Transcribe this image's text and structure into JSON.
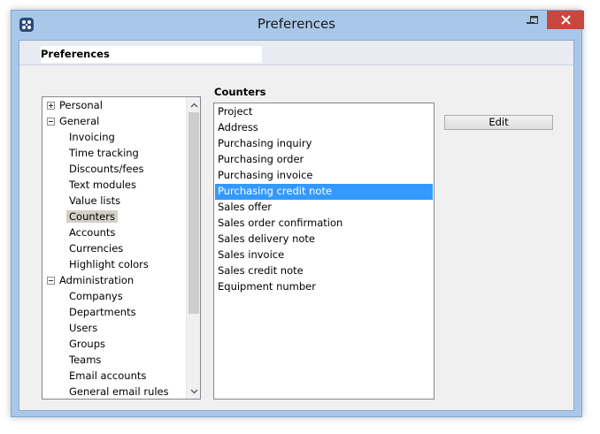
{
  "window": {
    "title": "Preferences"
  },
  "tab": {
    "title": "Preferences"
  },
  "tree": {
    "items": [
      {
        "label": "Personal",
        "level": 0,
        "expander": "plus"
      },
      {
        "label": "General",
        "level": 0,
        "expander": "minus"
      },
      {
        "label": "Invoicing",
        "level": 1
      },
      {
        "label": "Time tracking",
        "level": 1
      },
      {
        "label": "Discounts/fees",
        "level": 1
      },
      {
        "label": "Text modules",
        "level": 1
      },
      {
        "label": "Value lists",
        "level": 1
      },
      {
        "label": "Counters",
        "level": 1,
        "selected": true
      },
      {
        "label": "Accounts",
        "level": 1
      },
      {
        "label": "Currencies",
        "level": 1
      },
      {
        "label": "Highlight colors",
        "level": 1
      },
      {
        "label": "Administration",
        "level": 0,
        "expander": "minus"
      },
      {
        "label": "Companys",
        "level": 1
      },
      {
        "label": "Departments",
        "level": 1
      },
      {
        "label": "Users",
        "level": 1
      },
      {
        "label": "Groups",
        "level": 1
      },
      {
        "label": "Teams",
        "level": 1
      },
      {
        "label": "Email accounts",
        "level": 1
      },
      {
        "label": "General email rules",
        "level": 1
      }
    ]
  },
  "counters": {
    "title": "Counters",
    "items": [
      "Project",
      "Address",
      "Purchasing inquiry",
      "Purchasing order",
      "Purchasing invoice",
      "Purchasing credit note",
      "Sales offer",
      "Sales order confirmation",
      "Sales delivery note",
      "Sales invoice",
      "Sales credit note",
      "Equipment number"
    ],
    "selected_index": 5,
    "edit_label": "Edit"
  },
  "icons": {
    "app": "app-logo-icon",
    "minimize": "minimize-icon",
    "maximize": "maximize-icon",
    "close": "close-icon",
    "scroll_up": "chevron-up-icon",
    "scroll_down": "chevron-down-icon"
  },
  "colors": {
    "selection": "#3399ff",
    "close_button": "#c7463d",
    "window_frame": "#a9c8e9"
  }
}
